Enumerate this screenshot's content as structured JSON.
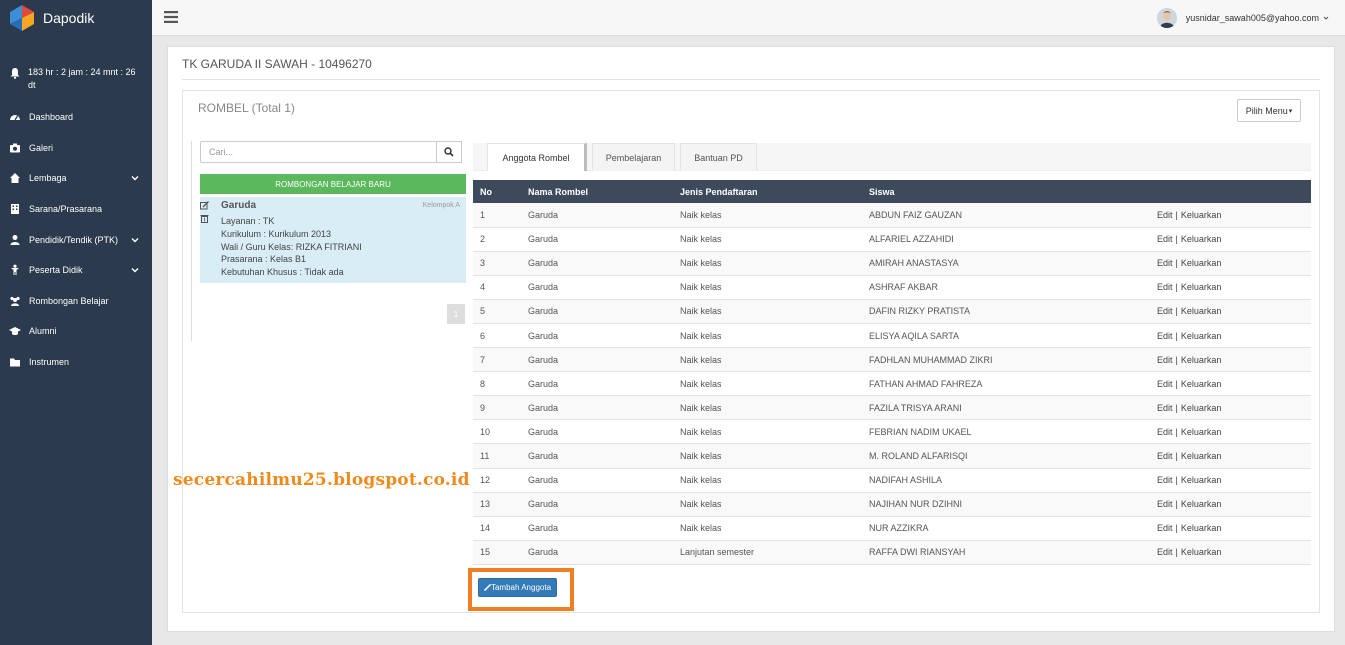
{
  "brand": {
    "name": "Dapodik",
    "colors": {
      "red": "#e2493b",
      "blue": "#3b8fd6",
      "orange": "#f5a623"
    }
  },
  "timer": "183 hr : 2 jam : 24 mnt : 26 dt",
  "nav": [
    {
      "label": "Dashboard",
      "icon": "dashboard-icon"
    },
    {
      "label": "Galeri",
      "icon": "camera-icon"
    },
    {
      "label": "Lembaga",
      "icon": "home-icon"
    },
    {
      "label": "Sarana/Prasarana",
      "icon": "building-icon"
    },
    {
      "label": "Pendidik/Tendik (PTK)",
      "icon": "user-icon"
    },
    {
      "label": "Peserta Didik",
      "icon": "child-icon"
    },
    {
      "label": "Rombongan Belajar",
      "icon": "users-icon"
    },
    {
      "label": "Alumni",
      "icon": "graduation-cap-icon"
    },
    {
      "label": "Instrumen",
      "icon": "folder-icon"
    }
  ],
  "user": {
    "email": "yusnidar_sawah005@yahoo.com"
  },
  "page_title": "TK GARUDA II SAWAH - 10496270",
  "box": {
    "title": "ROMBEL (Total 1)",
    "menu_label": "Pilih Menu"
  },
  "search": {
    "placeholder": "Cari..."
  },
  "new_button": "ROMBONGAN BELAJAR BARU",
  "rombel_card": {
    "name": "Garuda",
    "group": "Kelompok A",
    "layanan": "Layanan : TK",
    "kurikulum": "Kurikulum : Kurikulum 2013",
    "wali": "Wali / Guru Kelas: RIZKA FITRIANI",
    "prasarana": "Prasarana : Kelas B1",
    "kebutuhan": "Kebutuhan Khusus : Tidak ada"
  },
  "pager": "1",
  "tabs": [
    "Anggota Rombel",
    "Pembelajaran",
    "Bantuan PD"
  ],
  "table": {
    "headers": [
      "No",
      "Nama Rombel",
      "Jenis Pendaftaran",
      "Siswa",
      ""
    ],
    "edit": "Edit",
    "sep": "|",
    "remove": "Keluarkan",
    "rows": [
      [
        "1",
        "Garuda",
        "Naik kelas",
        "ABDUN FAIZ GAUZAN"
      ],
      [
        "2",
        "Garuda",
        "Naik kelas",
        "ALFARIEL AZZAHIDI"
      ],
      [
        "3",
        "Garuda",
        "Naik kelas",
        "AMIRAH ANASTASYA"
      ],
      [
        "4",
        "Garuda",
        "Naik kelas",
        "ASHRAF AKBAR"
      ],
      [
        "5",
        "Garuda",
        "Naik kelas",
        "DAFIN RIZKY PRATISTA"
      ],
      [
        "6",
        "Garuda",
        "Naik kelas",
        "ELISYA AQILA SARTA"
      ],
      [
        "7",
        "Garuda",
        "Naik kelas",
        "FADHLAN MUHAMMAD ZIKRI"
      ],
      [
        "8",
        "Garuda",
        "Naik kelas",
        "FATHAN AHMAD FAHREZA"
      ],
      [
        "9",
        "Garuda",
        "Naik kelas",
        "FAZILA TRISYA ARANI"
      ],
      [
        "10",
        "Garuda",
        "Naik kelas",
        "FEBRIAN NADIM UKAEL"
      ],
      [
        "11",
        "Garuda",
        "Naik kelas",
        "M. ROLAND ALFARISQI"
      ],
      [
        "12",
        "Garuda",
        "Naik kelas",
        "NADIFAH ASHILA"
      ],
      [
        "13",
        "Garuda",
        "Naik kelas",
        "NAJIHAN NUR DZIHNI"
      ],
      [
        "14",
        "Garuda",
        "Naik kelas",
        "NUR AZZIKRA"
      ],
      [
        "15",
        "Garuda",
        "Lanjutan semester",
        "RAFFA DWI RIANSYAH"
      ]
    ]
  },
  "add_button": "Tambah Anggota",
  "watermark": "secercahilmu25.blogspot.co.id",
  "highlight_color": "#f07f23"
}
